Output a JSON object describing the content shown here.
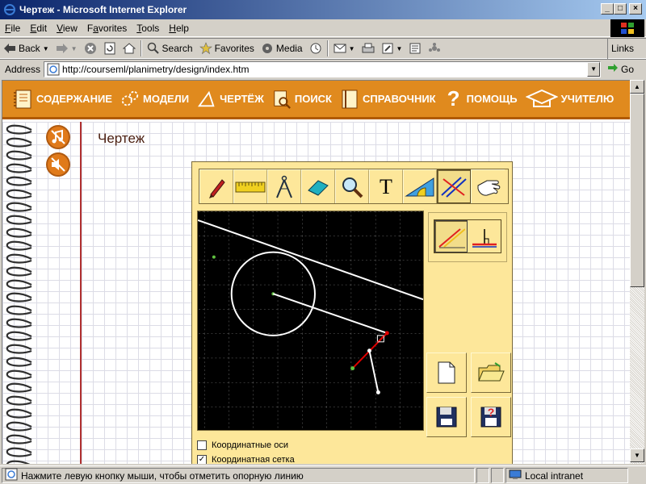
{
  "window": {
    "title": "Чертеж - Microsoft Internet Explorer",
    "buttons": {
      "minimize": "_",
      "maximize": "□",
      "close": "×"
    }
  },
  "menu": [
    {
      "label": "File",
      "underline": "F",
      "rest": "ile"
    },
    {
      "label": "Edit",
      "underline": "E",
      "rest": "dit"
    },
    {
      "label": "View",
      "underline": "V",
      "rest": "iew"
    },
    {
      "label": "Favorites",
      "underline": "a",
      "pre": "F",
      "rest": "vorites"
    },
    {
      "label": "Tools",
      "underline": "T",
      "rest": "ools"
    },
    {
      "label": "Help",
      "underline": "H",
      "rest": "elp"
    }
  ],
  "toolbar": {
    "back": "Back",
    "search": "Search",
    "favorites": "Favorites",
    "media": "Media",
    "links": "Links"
  },
  "address": {
    "label": "Address",
    "url": "http://courseml/planimetry/design/index.htm",
    "go": "Go"
  },
  "site_nav": [
    {
      "label": "СОДЕРЖАНИЕ",
      "icon": "contents-book-icon"
    },
    {
      "label": "МОДЕЛИ",
      "icon": "gears-icon"
    },
    {
      "label": "ЧЕРТЁЖ",
      "icon": "triangle-drawing-icon"
    },
    {
      "label": "ПОИСК",
      "icon": "search-document-icon"
    },
    {
      "label": "СПРАВОЧНИК",
      "icon": "reference-book-icon"
    },
    {
      "label": "ПОМОЩЬ",
      "icon": "question-mark-icon"
    },
    {
      "label": "УЧИТЕЛЮ",
      "icon": "graduation-cap-icon"
    }
  ],
  "page": {
    "heading": "Чертеж"
  },
  "applet": {
    "tools": [
      {
        "name": "pencil",
        "active": false
      },
      {
        "name": "ruler",
        "active": false
      },
      {
        "name": "compass",
        "active": false
      },
      {
        "name": "eraser",
        "active": false
      },
      {
        "name": "magnifier",
        "active": false
      },
      {
        "name": "text",
        "label": "T",
        "active": false
      },
      {
        "name": "protractor-set-square",
        "active": false
      },
      {
        "name": "parallel-lines",
        "active": true
      },
      {
        "name": "hand",
        "active": false
      }
    ],
    "modes": [
      {
        "name": "parallel-mode",
        "active": true
      },
      {
        "name": "perpendicular-mode",
        "active": false
      }
    ],
    "checkboxes": [
      {
        "label": "Координатные оси",
        "checked": false
      },
      {
        "label": "Координатная сетка",
        "checked": true
      }
    ],
    "colors": {
      "background": "#fde79a",
      "canvas": "#000000",
      "accent_red": "#e00000"
    }
  },
  "status": {
    "message": "Нажмите левую кнопку мыши, чтобы отметить опорную линию",
    "zone": "Local intranet"
  },
  "colors": {
    "titlebar_start": "#0a246a",
    "titlebar_end": "#a6caf0",
    "site_nav_bg": "#e08a1e"
  }
}
